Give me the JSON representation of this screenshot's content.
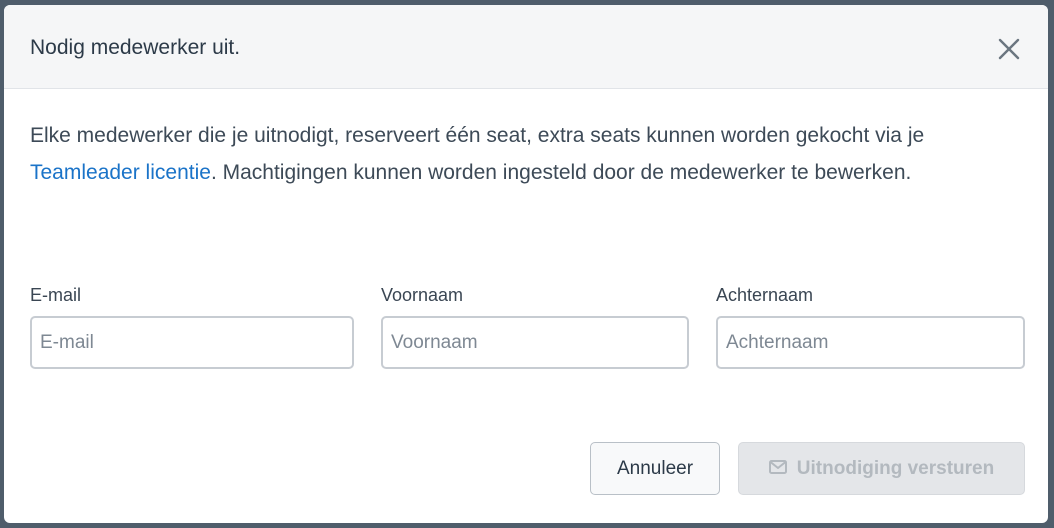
{
  "modal": {
    "title": "Nodig medewerker uit.",
    "close_icon": "close-icon",
    "description_part1": "Elke medewerker die je uitnodigt, reserveert één seat, extra seats kunnen worden gekocht via je ",
    "description_link": "Teamleader licentie",
    "description_part2": ". Machtigingen kunnen worden ingesteld door de medewerker te bewerken."
  },
  "form": {
    "email": {
      "label": "E-mail",
      "placeholder": "E-mail",
      "value": ""
    },
    "first_name": {
      "label": "Voornaam",
      "placeholder": "Voornaam",
      "value": ""
    },
    "last_name": {
      "label": "Achternaam",
      "placeholder": "Achternaam",
      "value": ""
    }
  },
  "actions": {
    "cancel_label": "Annuleer",
    "send_label": "Uitnodiging versturen",
    "send_icon": "mail-icon",
    "send_disabled": true
  },
  "colors": {
    "link": "#1a73c8",
    "header_bg": "#f5f6f7",
    "disabled_button_bg": "#e4e6e9",
    "disabled_button_text": "#b3b9bf"
  }
}
